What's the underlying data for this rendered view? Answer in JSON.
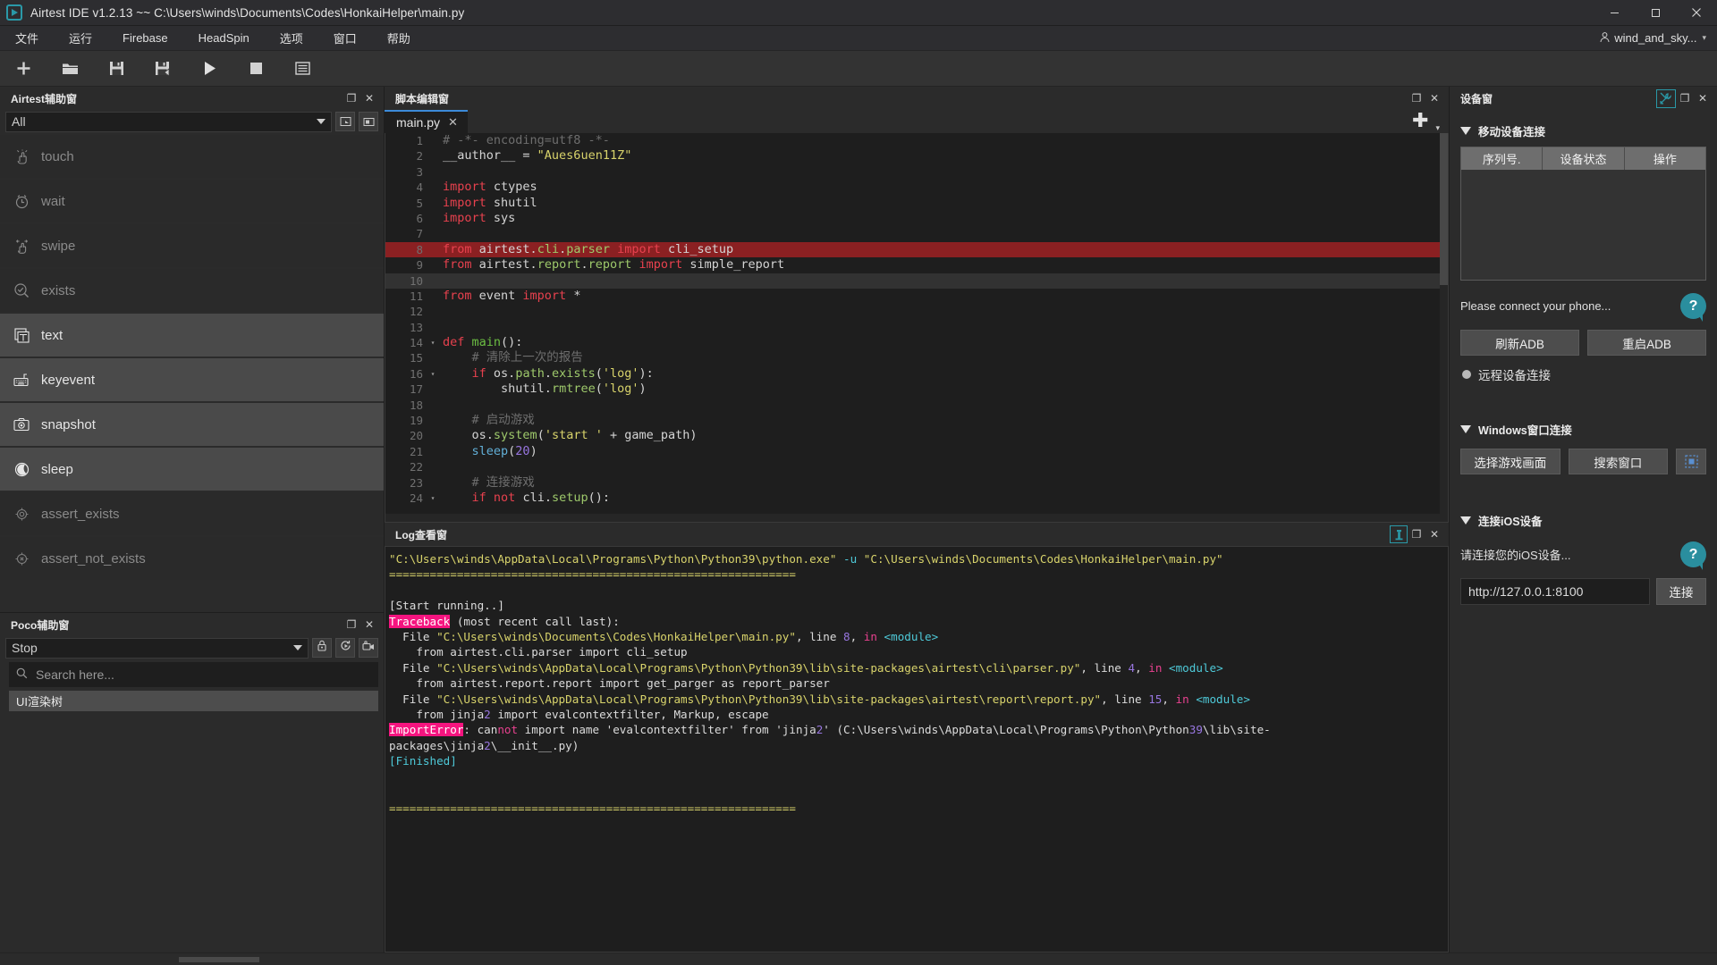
{
  "window": {
    "title": "Airtest IDE v1.2.13 ~~ C:\\Users\\winds\\Documents\\Codes\\HonkaiHelper\\main.py",
    "logo_glyph": "▶",
    "minimize": "—",
    "maximize": "❐",
    "close": "✕"
  },
  "menubar": {
    "items": [
      {
        "label": "文件",
        "name": "menu-file"
      },
      {
        "label": "运行",
        "name": "menu-run"
      },
      {
        "label": "Firebase",
        "name": "menu-firebase"
      },
      {
        "label": "HeadSpin",
        "name": "menu-headspin"
      },
      {
        "label": "选项",
        "name": "menu-options"
      },
      {
        "label": "窗口",
        "name": "menu-window"
      },
      {
        "label": "帮助",
        "name": "menu-help"
      }
    ],
    "user": "wind_and_sky...",
    "user_caret": "▾"
  },
  "toolbar": {
    "buttons": [
      {
        "name": "new-script-button",
        "icon": "plus-icon"
      },
      {
        "name": "open-script-button",
        "icon": "folder-icon"
      },
      {
        "name": "save-button",
        "icon": "save-icon"
      },
      {
        "name": "save-as-button",
        "icon": "save-as-icon"
      },
      {
        "name": "run-button",
        "icon": "play-icon"
      },
      {
        "name": "stop-button",
        "icon": "stop-icon"
      },
      {
        "name": "report-button",
        "icon": "report-icon"
      }
    ]
  },
  "airtest_panel": {
    "title": "Airtest辅助窗",
    "filter_value": "All",
    "actions": [
      {
        "label": "touch",
        "icon": "touch-hand-icon",
        "enabled": false
      },
      {
        "label": "wait",
        "icon": "clock-icon",
        "enabled": false
      },
      {
        "label": "swipe",
        "icon": "swipe-hand-icon",
        "enabled": false
      },
      {
        "label": "exists",
        "icon": "magnifier-check-icon",
        "enabled": false
      },
      {
        "label": "text",
        "icon": "text-box-icon",
        "enabled": true
      },
      {
        "label": "keyevent",
        "icon": "keyboard-icon",
        "enabled": true
      },
      {
        "label": "snapshot",
        "icon": "camera-icon",
        "enabled": true
      },
      {
        "label": "sleep",
        "icon": "moon-icon",
        "enabled": true
      },
      {
        "label": "assert_exists",
        "icon": "target-icon",
        "enabled": false
      },
      {
        "label": "assert_not_exists",
        "icon": "target-cross-icon",
        "enabled": false
      }
    ],
    "header_icons": [
      {
        "name": "restore-icon",
        "glyph": "❐"
      },
      {
        "name": "close-icon",
        "glyph": "✕"
      }
    ],
    "filter_buttons": [
      {
        "name": "select-device-screen-button",
        "glyph": "▣"
      },
      {
        "name": "capture-button",
        "glyph": "▥"
      }
    ]
  },
  "poco_panel": {
    "title": "Poco辅助窗",
    "mode_value": "Stop",
    "search_placeholder": "Search here...",
    "tree_root": "UI渲染树",
    "control_icons": [
      {
        "name": "lock-icon",
        "glyph": "🔒"
      },
      {
        "name": "refresh-icon",
        "glyph": "⟳"
      },
      {
        "name": "record-camera-icon",
        "glyph": "🎥"
      }
    ],
    "header_icons": [
      {
        "name": "restore-icon",
        "glyph": "❐"
      },
      {
        "name": "close-icon",
        "glyph": "✕"
      }
    ]
  },
  "editor_panel": {
    "title": "脚本编辑窗",
    "header_icons": [
      {
        "name": "restore-icon",
        "glyph": "❐"
      },
      {
        "name": "close-icon",
        "glyph": "✕"
      }
    ],
    "tab": {
      "label": "main.py",
      "close": "✕"
    },
    "add_tab": "✚",
    "add_tab_caret": "▾",
    "lines": [
      {
        "n": "1",
        "fold": "",
        "state": "",
        "tokens": [
          {
            "t": "# -*- encoding=utf8 -*-",
            "c": "cm"
          }
        ]
      },
      {
        "n": "2",
        "fold": "",
        "state": "",
        "tokens": [
          {
            "t": "__author__ ",
            "c": "plain"
          },
          {
            "t": "= ",
            "c": "plain"
          },
          {
            "t": "\"Aues6uen11Z\"",
            "c": "str"
          }
        ]
      },
      {
        "n": "3",
        "fold": "",
        "state": "",
        "tokens": [
          {
            "t": "",
            "c": "plain"
          }
        ]
      },
      {
        "n": "4",
        "fold": "",
        "state": "",
        "tokens": [
          {
            "t": "import",
            "c": "kw"
          },
          {
            "t": " ctypes",
            "c": "plain"
          }
        ]
      },
      {
        "n": "5",
        "fold": "",
        "state": "",
        "tokens": [
          {
            "t": "import",
            "c": "kw"
          },
          {
            "t": " shutil",
            "c": "plain"
          }
        ]
      },
      {
        "n": "6",
        "fold": "",
        "state": "",
        "tokens": [
          {
            "t": "import",
            "c": "kw"
          },
          {
            "t": " sys",
            "c": "plain"
          }
        ]
      },
      {
        "n": "7",
        "fold": "",
        "state": "",
        "tokens": [
          {
            "t": "",
            "c": "plain"
          }
        ]
      },
      {
        "n": "8",
        "fold": "",
        "state": "err",
        "tokens": [
          {
            "t": "from",
            "c": "kw"
          },
          {
            "t": " airtest",
            "c": "plain"
          },
          {
            "t": ".",
            "c": "plain"
          },
          {
            "t": "cli",
            "c": "nm"
          },
          {
            "t": ".",
            "c": "plain"
          },
          {
            "t": "parser ",
            "c": "nm"
          },
          {
            "t": "import",
            "c": "kw"
          },
          {
            "t": " cli_setup",
            "c": "plain"
          }
        ]
      },
      {
        "n": "9",
        "fold": "",
        "state": "",
        "tokens": [
          {
            "t": "from",
            "c": "kw"
          },
          {
            "t": " airtest",
            "c": "plain"
          },
          {
            "t": ".",
            "c": "plain"
          },
          {
            "t": "report",
            "c": "nm"
          },
          {
            "t": ".",
            "c": "plain"
          },
          {
            "t": "report ",
            "c": "nm"
          },
          {
            "t": "import",
            "c": "kw"
          },
          {
            "t": " simple_report",
            "c": "plain"
          }
        ]
      },
      {
        "n": "10",
        "fold": "",
        "state": "cur",
        "tokens": [
          {
            "t": "",
            "c": "plain"
          }
        ]
      },
      {
        "n": "11",
        "fold": "",
        "state": "",
        "tokens": [
          {
            "t": "from",
            "c": "kw"
          },
          {
            "t": " event ",
            "c": "plain"
          },
          {
            "t": "import",
            "c": "kw"
          },
          {
            "t": " *",
            "c": "plain"
          }
        ]
      },
      {
        "n": "12",
        "fold": "",
        "state": "",
        "tokens": [
          {
            "t": "",
            "c": "plain"
          }
        ]
      },
      {
        "n": "13",
        "fold": "",
        "state": "",
        "tokens": [
          {
            "t": "",
            "c": "plain"
          }
        ]
      },
      {
        "n": "14",
        "fold": "▾",
        "state": "",
        "tokens": [
          {
            "t": "def",
            "c": "kw"
          },
          {
            "t": " ",
            "c": "plain"
          },
          {
            "t": "main",
            "c": "fn"
          },
          {
            "t": "():",
            "c": "plain"
          }
        ]
      },
      {
        "n": "15",
        "fold": "",
        "state": "",
        "tokens": [
          {
            "t": "    # 清除上一次的报告",
            "c": "cm"
          }
        ]
      },
      {
        "n": "16",
        "fold": "▾",
        "state": "",
        "tokens": [
          {
            "t": "    ",
            "c": "plain"
          },
          {
            "t": "if",
            "c": "kw"
          },
          {
            "t": " os",
            "c": "plain"
          },
          {
            "t": ".",
            "c": "plain"
          },
          {
            "t": "path",
            "c": "nm"
          },
          {
            "t": ".",
            "c": "plain"
          },
          {
            "t": "exists",
            "c": "nm"
          },
          {
            "t": "(",
            "c": "plain"
          },
          {
            "t": "'log'",
            "c": "str"
          },
          {
            "t": "):",
            "c": "plain"
          }
        ]
      },
      {
        "n": "17",
        "fold": "",
        "state": "",
        "tokens": [
          {
            "t": "        shutil",
            "c": "plain"
          },
          {
            "t": ".",
            "c": "plain"
          },
          {
            "t": "rmtree",
            "c": "nm"
          },
          {
            "t": "(",
            "c": "plain"
          },
          {
            "t": "'log'",
            "c": "str"
          },
          {
            "t": ")",
            "c": "plain"
          }
        ]
      },
      {
        "n": "18",
        "fold": "",
        "state": "",
        "tokens": [
          {
            "t": "",
            "c": "plain"
          }
        ]
      },
      {
        "n": "19",
        "fold": "",
        "state": "",
        "tokens": [
          {
            "t": "    # 启动游戏",
            "c": "cm"
          }
        ]
      },
      {
        "n": "20",
        "fold": "",
        "state": "",
        "tokens": [
          {
            "t": "    os",
            "c": "plain"
          },
          {
            "t": ".",
            "c": "plain"
          },
          {
            "t": "system",
            "c": "nm"
          },
          {
            "t": "(",
            "c": "plain"
          },
          {
            "t": "'start '",
            "c": "str"
          },
          {
            "t": " + game_path)",
            "c": "plain"
          }
        ]
      },
      {
        "n": "21",
        "fold": "",
        "state": "",
        "tokens": [
          {
            "t": "    ",
            "c": "plain"
          },
          {
            "t": "sleep",
            "c": "bi"
          },
          {
            "t": "(",
            "c": "plain"
          },
          {
            "t": "20",
            "c": "num"
          },
          {
            "t": ")",
            "c": "plain"
          }
        ]
      },
      {
        "n": "22",
        "fold": "",
        "state": "",
        "tokens": [
          {
            "t": "",
            "c": "plain"
          }
        ]
      },
      {
        "n": "23",
        "fold": "",
        "state": "",
        "tokens": [
          {
            "t": "    # 连接游戏",
            "c": "cm"
          }
        ]
      },
      {
        "n": "24",
        "fold": "▾",
        "state": "",
        "tokens": [
          {
            "t": "    ",
            "c": "plain"
          },
          {
            "t": "if",
            "c": "kw"
          },
          {
            "t": " ",
            "c": "plain"
          },
          {
            "t": "not",
            "c": "kw"
          },
          {
            "t": " cli",
            "c": "plain"
          },
          {
            "t": ".",
            "c": "plain"
          },
          {
            "t": "setup",
            "c": "nm"
          },
          {
            "t": "():",
            "c": "plain"
          }
        ]
      }
    ]
  },
  "log_panel": {
    "title": "Log查看窗",
    "header_icons": [
      {
        "name": "clear-log-icon",
        "glyph": "🗑",
        "active": true
      },
      {
        "name": "restore-icon",
        "glyph": "❐",
        "active": false
      },
      {
        "name": "close-icon",
        "glyph": "✕",
        "active": false
      }
    ],
    "lines": [
      [
        {
          "t": "\"C:\\Users\\winds\\AppData\\Local\\Programs\\Python\\Python39\\python.exe\"",
          "c": "lg-y"
        },
        {
          "t": " ",
          "c": "lg-w"
        },
        {
          "t": "-u",
          "c": "lg-c"
        },
        {
          "t": " ",
          "c": "lg-w"
        },
        {
          "t": "\"C:\\Users\\winds\\Documents\\Codes\\HonkaiHelper\\main.py\"",
          "c": "lg-y"
        }
      ],
      [
        {
          "t": "============================================================",
          "c": "lg-y"
        }
      ],
      [
        {
          "t": "",
          "c": "lg-w"
        }
      ],
      [
        {
          "t": "[Start running..]",
          "c": "lg-w"
        }
      ],
      [
        {
          "t": "Traceback",
          "c": "hl-pink"
        },
        {
          "t": " (most recent call last):",
          "c": "lg-w"
        }
      ],
      [
        {
          "t": "  File ",
          "c": "lg-w"
        },
        {
          "t": "\"C:\\Users\\winds\\Documents\\Codes\\HonkaiHelper\\main.py\"",
          "c": "lg-y"
        },
        {
          "t": ", line ",
          "c": "lg-w"
        },
        {
          "t": "8",
          "c": "lg-n"
        },
        {
          "t": ", ",
          "c": "lg-w"
        },
        {
          "t": "in",
          "c": "lg-p"
        },
        {
          "t": " ",
          "c": "lg-w"
        },
        {
          "t": "<module>",
          "c": "lg-c"
        }
      ],
      [
        {
          "t": "    from airtest.cli.parser import cli_setup",
          "c": "lg-w"
        }
      ],
      [
        {
          "t": "  File ",
          "c": "lg-w"
        },
        {
          "t": "\"C:\\Users\\winds\\AppData\\Local\\Programs\\Python\\Python39\\lib\\site-packages\\airtest\\cli\\parser.py\"",
          "c": "lg-y"
        },
        {
          "t": ", line ",
          "c": "lg-w"
        },
        {
          "t": "4",
          "c": "lg-n"
        },
        {
          "t": ", ",
          "c": "lg-w"
        },
        {
          "t": "in",
          "c": "lg-p"
        },
        {
          "t": " ",
          "c": "lg-w"
        },
        {
          "t": "<module>",
          "c": "lg-c"
        }
      ],
      [
        {
          "t": "    from airtest.report.report import get_parger as report_parser",
          "c": "lg-w"
        }
      ],
      [
        {
          "t": "  File ",
          "c": "lg-w"
        },
        {
          "t": "\"C:\\Users\\winds\\AppData\\Local\\Programs\\Python\\Python39\\lib\\site-packages\\airtest\\report\\report.py\"",
          "c": "lg-y"
        },
        {
          "t": ", line ",
          "c": "lg-w"
        },
        {
          "t": "15",
          "c": "lg-n"
        },
        {
          "t": ", ",
          "c": "lg-w"
        },
        {
          "t": "in",
          "c": "lg-p"
        },
        {
          "t": " ",
          "c": "lg-w"
        },
        {
          "t": "<module>",
          "c": "lg-c"
        }
      ],
      [
        {
          "t": "    from jinja",
          "c": "lg-w"
        },
        {
          "t": "2",
          "c": "lg-n"
        },
        {
          "t": " import evalcontextfilter, Markup, escape",
          "c": "lg-w"
        }
      ],
      [
        {
          "t": "ImportError",
          "c": "hl-pink"
        },
        {
          "t": ": can",
          "c": "lg-w"
        },
        {
          "t": "not",
          "c": "lg-p"
        },
        {
          "t": " import name 'evalcontextfilter' from 'jinja",
          "c": "lg-w"
        },
        {
          "t": "2",
          "c": "lg-n"
        },
        {
          "t": "' (C:\\Users\\winds\\AppData\\Local\\Programs\\Python\\Python",
          "c": "lg-w"
        },
        {
          "t": "39",
          "c": "lg-n"
        },
        {
          "t": "\\lib\\site-",
          "c": "lg-w"
        }
      ],
      [
        {
          "t": "packages\\jinja",
          "c": "lg-w"
        },
        {
          "t": "2",
          "c": "lg-n"
        },
        {
          "t": "\\__init__.py)",
          "c": "lg-w"
        }
      ],
      [
        {
          "t": "[Finished]",
          "c": "lg-c"
        }
      ],
      [
        {
          "t": "",
          "c": "lg-w"
        }
      ],
      [
        {
          "t": "",
          "c": "lg-w"
        }
      ],
      [
        {
          "t": "============================================================",
          "c": "lg-y"
        }
      ]
    ]
  },
  "device_panel": {
    "title": "设备窗",
    "header_icons": [
      {
        "name": "wrench-icon",
        "glyph": "⚒",
        "active": true
      },
      {
        "name": "restore-icon",
        "glyph": "❐",
        "active": false
      },
      {
        "name": "close-icon",
        "glyph": "✕",
        "active": false
      }
    ],
    "mobile_section": {
      "title": "移动设备连接",
      "columns": [
        "序列号.",
        "设备状态",
        "操作"
      ],
      "hint": "Please connect your phone...",
      "help_glyph": "?",
      "refresh_adb": "刷新ADB",
      "restart_adb": "重启ADB",
      "remote_label": "远程设备连接"
    },
    "windows_section": {
      "title": "Windows窗口连接",
      "select_screen": "选择游戏画面",
      "search_window": "搜索窗口",
      "extra_glyph": "▣"
    },
    "ios_section": {
      "title": "连接iOS设备",
      "hint": "请连接您的iOS设备...",
      "help_glyph": "?",
      "address": "http://127.0.0.1:8100",
      "connect": "连接"
    }
  }
}
